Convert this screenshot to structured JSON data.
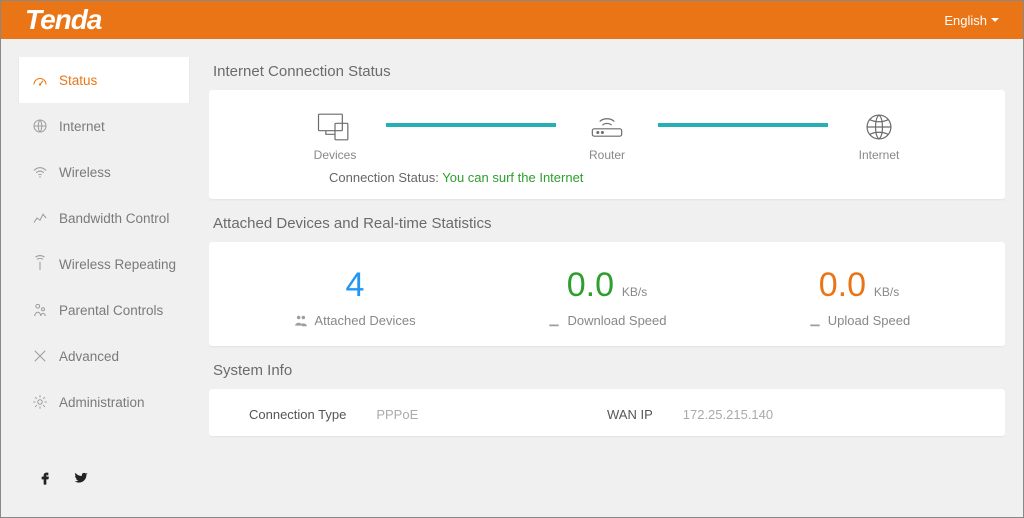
{
  "header": {
    "brand": "Tenda",
    "language": "English"
  },
  "sidebar": {
    "items": [
      {
        "label": "Status",
        "active": true
      },
      {
        "label": "Internet"
      },
      {
        "label": "Wireless"
      },
      {
        "label": "Bandwidth Control"
      },
      {
        "label": "Wireless Repeating"
      },
      {
        "label": "Parental Controls"
      },
      {
        "label": "Advanced"
      },
      {
        "label": "Administration"
      }
    ]
  },
  "status": {
    "section_title": "Internet Connection Status",
    "topology": {
      "devices": "Devices",
      "router": "Router",
      "internet": "Internet"
    },
    "conn_label": "Connection Status:",
    "conn_value": "You can surf the Internet"
  },
  "stats": {
    "section_title": "Attached Devices and Real-time Statistics",
    "attached": {
      "value": "4",
      "label": "Attached Devices"
    },
    "download": {
      "value": "0.0",
      "unit": "KB/s",
      "label": "Download Speed"
    },
    "upload": {
      "value": "0.0",
      "unit": "KB/s",
      "label": "Upload Speed"
    }
  },
  "sysinfo": {
    "section_title": "System Info",
    "conn_type_label": "Connection Type",
    "conn_type_value": "PPPoE",
    "wan_ip_label": "WAN IP",
    "wan_ip_value": "172.25.215.140"
  }
}
